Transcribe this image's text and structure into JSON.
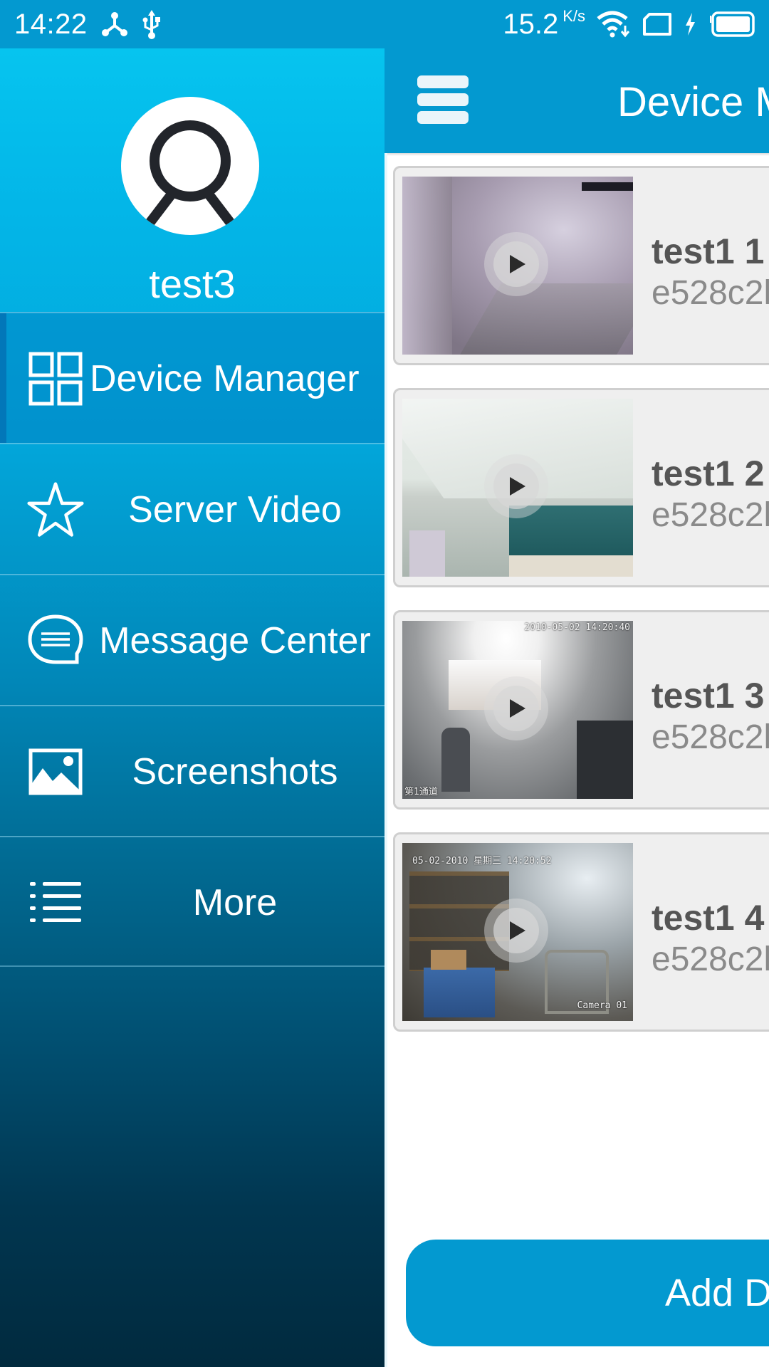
{
  "status_bar": {
    "time": "14:22",
    "left_icons": [
      "network-share-icon",
      "usb-icon"
    ],
    "net_speed_value": "15.2",
    "net_speed_unit": "K/s",
    "right_icons": [
      "wifi-download-icon",
      "sim-card-icon",
      "charging-bolt-icon",
      "battery-full-icon"
    ]
  },
  "drawer": {
    "username": "test3",
    "avatar_icon": "user-avatar-icon",
    "items": [
      {
        "label": "Device Manager",
        "icon": "grid-icon",
        "active": true
      },
      {
        "label": "Server Video",
        "icon": "star-icon",
        "active": false
      },
      {
        "label": "Message Center",
        "icon": "chat-bubble-icon",
        "active": false
      },
      {
        "label": "Screenshots",
        "icon": "image-icon",
        "active": false
      },
      {
        "label": "More",
        "icon": "list-icon",
        "active": false
      }
    ]
  },
  "appbar": {
    "menu_icon": "hamburger-menu-icon",
    "title": "Device M"
  },
  "devices": [
    {
      "name": "test1 1",
      "id": "e528c2l",
      "osd_top": "",
      "osd_bottom": "",
      "scene": "outdoor"
    },
    {
      "name": "test1 2",
      "id": "e528c2l",
      "osd_top": "",
      "osd_bottom": "",
      "scene": "ceiling"
    },
    {
      "name": "test1 3",
      "id": "e528c2l",
      "osd_top": "2010-05-02 14:20:40",
      "osd_bottom": "第1通道",
      "scene": "window"
    },
    {
      "name": "test1 4",
      "id": "e528c2l",
      "osd_top": "05-02-2010 星期三 14:20:52",
      "osd_bottom": "Camera 01",
      "scene": "storage"
    }
  ],
  "add_button": {
    "label": "Add D"
  },
  "colors": {
    "primary": "#0399d0",
    "card_bg": "#efefef",
    "device_name": "#555555",
    "device_id": "#8a8a8a"
  }
}
